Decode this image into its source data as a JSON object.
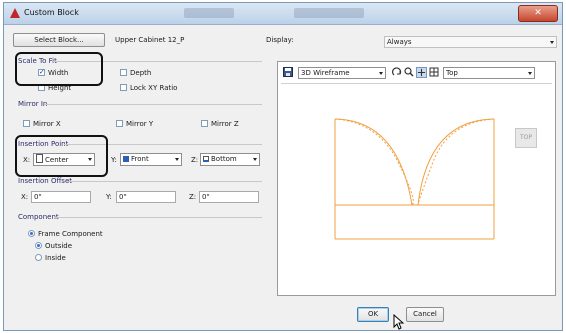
{
  "window": {
    "title": "Custom Block",
    "close_glyph": "✕"
  },
  "top": {
    "select_block_label": "Select Block...",
    "block_name": "Upper Cabinet 12_P",
    "display_label": "Display:",
    "display_value": "Always"
  },
  "scale_to_fit": {
    "header": "Scale To Fit",
    "width": "Width",
    "depth": "Depth",
    "height": "Height",
    "lock_xy": "Lock XY Ratio"
  },
  "mirror_in": {
    "header": "Mirror In",
    "x": "Mirror X",
    "y": "Mirror Y",
    "z": "Mirror Z"
  },
  "insertion_point": {
    "header": "Insertion Point",
    "x_label": "X:",
    "x_value": "Center",
    "y_label": "Y:",
    "y_value": "Front",
    "z_label": "Z:",
    "z_value": "Bottom"
  },
  "insertion_offset": {
    "header": "Insertion Offset",
    "x_label": "X:",
    "x_value": "0\"",
    "y_label": "Y:",
    "y_value": "0\"",
    "z_label": "Z:",
    "z_value": "0\""
  },
  "component": {
    "header": "Component",
    "frame": "Frame Component",
    "outside": "Outside",
    "inside": "Inside"
  },
  "viewer": {
    "visual_style": "3D Wireframe",
    "view": "Top",
    "cube_label": "TOP"
  },
  "buttons": {
    "ok": "OK",
    "cancel": "Cancel"
  },
  "colors": {
    "highlight": "#111111",
    "drawing": "#f0a040"
  }
}
